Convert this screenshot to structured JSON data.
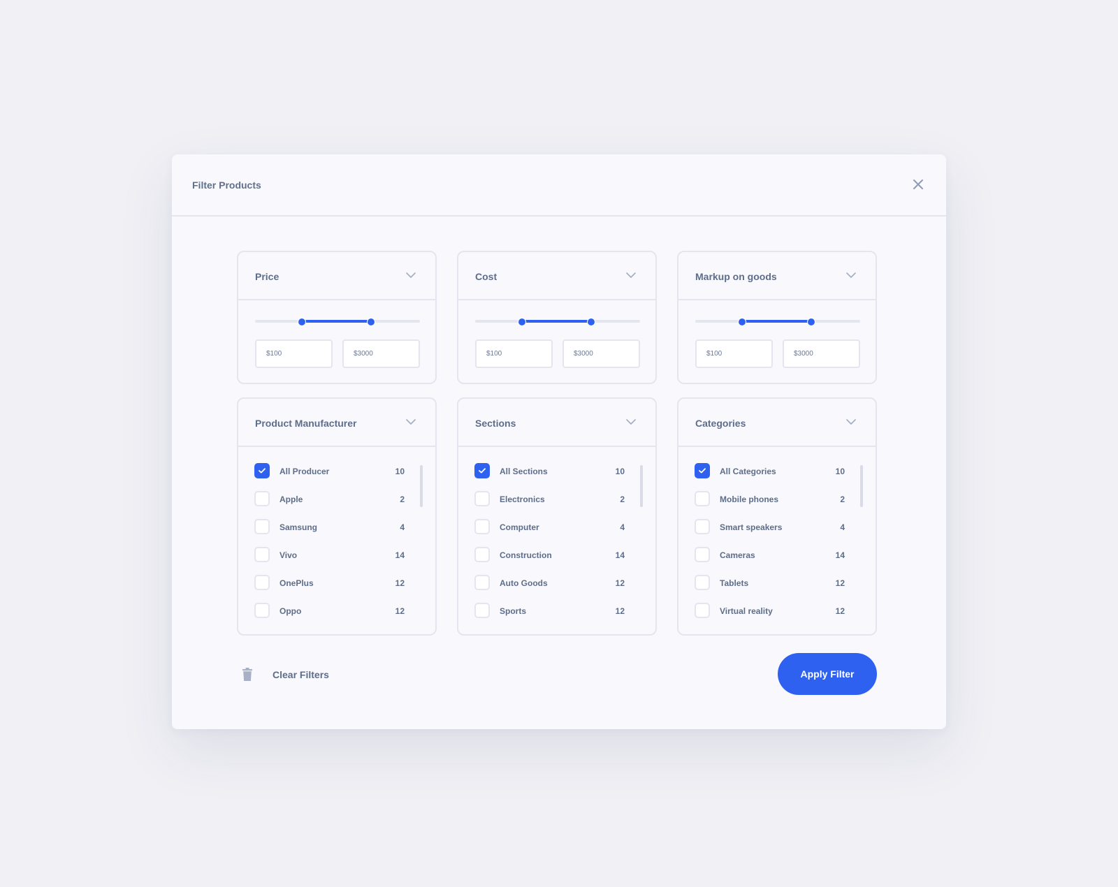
{
  "modal": {
    "title": "Filter Products",
    "close_icon": "close-icon"
  },
  "range_filters": [
    {
      "title": "Price",
      "min_value": "$100",
      "max_value": "$3000",
      "slider_low_fraction": 0.28,
      "slider_high_fraction": 0.7
    },
    {
      "title": "Cost",
      "min_value": "$100",
      "max_value": "$3000",
      "slider_low_fraction": 0.28,
      "slider_high_fraction": 0.7
    },
    {
      "title": "Markup on goods",
      "min_value": "$100",
      "max_value": "$3000",
      "slider_low_fraction": 0.28,
      "slider_high_fraction": 0.7
    }
  ],
  "list_filters": [
    {
      "title": "Product Manufacturer",
      "items": [
        {
          "label": "All Producer",
          "count": "10",
          "checked": true
        },
        {
          "label": "Apple",
          "count": "2",
          "checked": false
        },
        {
          "label": "Samsung",
          "count": "4",
          "checked": false
        },
        {
          "label": "Vivo",
          "count": "14",
          "checked": false
        },
        {
          "label": "OnePlus",
          "count": "12",
          "checked": false
        },
        {
          "label": "Oppo",
          "count": "12",
          "checked": false
        }
      ]
    },
    {
      "title": "Sections",
      "items": [
        {
          "label": "All Sections",
          "count": "10",
          "checked": true
        },
        {
          "label": "Electronics",
          "count": "2",
          "checked": false
        },
        {
          "label": "Computer",
          "count": "4",
          "checked": false
        },
        {
          "label": "Construction",
          "count": "14",
          "checked": false
        },
        {
          "label": "Auto Goods",
          "count": "12",
          "checked": false
        },
        {
          "label": "Sports",
          "count": "12",
          "checked": false
        }
      ]
    },
    {
      "title": "Categories",
      "items": [
        {
          "label": "All Categories",
          "count": "10",
          "checked": true
        },
        {
          "label": "Mobile phones",
          "count": "2",
          "checked": false
        },
        {
          "label": "Smart speakers",
          "count": "4",
          "checked": false
        },
        {
          "label": "Cameras",
          "count": "14",
          "checked": false
        },
        {
          "label": "Tablets",
          "count": "12",
          "checked": false
        },
        {
          "label": "Virtual reality",
          "count": "12",
          "checked": false
        }
      ]
    }
  ],
  "footer": {
    "clear_label": "Clear Filters",
    "clear_icon": "trash-icon",
    "apply_label": "Apply Filter"
  },
  "colors": {
    "accent": "#2e61f0",
    "background": "#f0f0f5",
    "panel": "#f9f9fd",
    "border": "#e4e5ee",
    "text": "#5d6d8a"
  }
}
